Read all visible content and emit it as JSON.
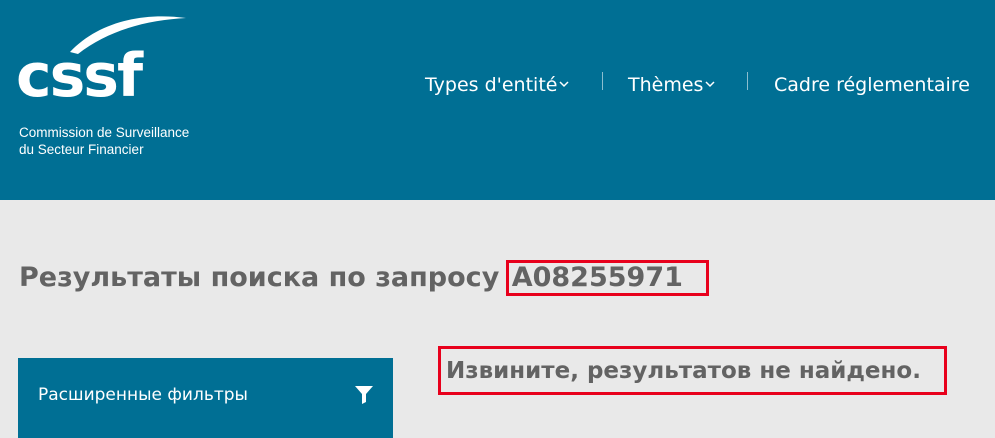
{
  "logo": {
    "mark": "cssf",
    "subtitle_line1": "Commission de Surveillance",
    "subtitle_line2": "du Secteur Financier"
  },
  "nav": {
    "items": [
      {
        "label": "Types d'entité",
        "has_dropdown": true
      },
      {
        "label": "Thèmes",
        "has_dropdown": true
      },
      {
        "label": "Cadre réglementaire",
        "has_dropdown": false
      }
    ]
  },
  "results": {
    "title_prefix": "Результаты поиска по запросу",
    "query": "A08255971",
    "no_results_message": "Извините, результатов не найдено."
  },
  "filters": {
    "label": "Расширенные фильтры",
    "icon": "funnel-icon"
  },
  "colors": {
    "brand_blue": "#006f94",
    "background": "#e9e9e9",
    "text_gray": "#636363",
    "highlight_red": "#e8001c"
  }
}
